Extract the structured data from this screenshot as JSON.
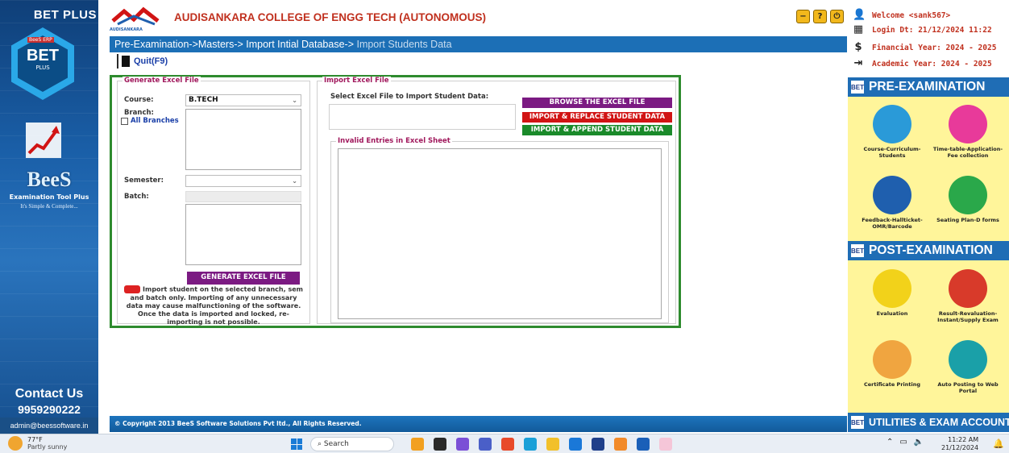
{
  "sidebar": {
    "brand": "BET PLUS",
    "hex_label": "BET",
    "hex_sublabel": "PLUS",
    "hex_tag": "BeeS ERP",
    "bees": "BeeS",
    "tagline": "Examination Tool Plus",
    "slogan": "It's Simple & Complete...",
    "contact_title": "Contact Us",
    "phone": "9959290222",
    "email": "admin@beessoftware.in"
  },
  "header": {
    "logo_text": "AUDISANKARA",
    "college": "AUDISANKARA COLLEGE OF ENGG  TECH (AUTONOMOUS)",
    "breadcrumb_active": "Pre-Examination->Masters-> Import Intial Database->",
    "breadcrumb_dim": " Import Students Data",
    "quit_label": "Quit(F9)",
    "window_buttons": [
      "minimize",
      "help",
      "power"
    ]
  },
  "generate": {
    "legend": "Generate Excel File",
    "course_label": "Course:",
    "course_value": "B.TECH",
    "branch_label": "Branch:",
    "all_branches_label": "All Branches",
    "semester_label": "Semester:",
    "semester_value": "",
    "batch_label": "Batch:",
    "generate_button": "GENERATE EXCEL FILE",
    "note": "Import student on the selected branch, sem and batch only.  Importing of any unnecessary data may cause malfunctioning of the software. Once the data is imported and locked, re-importing is not possible."
  },
  "import": {
    "legend": "Import Excel File",
    "select_label": "Select Excel File to Import Student Data:",
    "browse_button": "BROWSE THE EXCEL FILE",
    "replace_button": "IMPORT & REPLACE STUDENT DATA",
    "append_button": "IMPORT & APPEND STUDENT DATA",
    "invalid_legend": "Invalid Entries in Excel Sheet"
  },
  "footer": {
    "copyright": "© Copyright 2013 BeeS Software Solutions Pvt ltd., All Rights Reserved."
  },
  "userinfo": {
    "welcome": "Welcome <sank567>",
    "login": "Login Dt: 21/12/2024 11:22",
    "financial": "Financial Year: 2024 - 2025",
    "academic": "Academic Year: 2024 - 2025"
  },
  "modules": {
    "bet_badge": "BET",
    "pre_title": "PRE-EXAMINATION",
    "pre_items": [
      {
        "label": "Course-Curriculum-Students",
        "icon": "people-icon",
        "color": "#2a9ad8"
      },
      {
        "label": "Time-table-Application-Fee collection",
        "icon": "hourglass-icon",
        "color": "#e83a9a"
      },
      {
        "label": "Feedback-Hallticket-OMR/Barcode",
        "icon": "monitor-icon",
        "color": "#1f5fae"
      },
      {
        "label": "Seating Plan-D forms",
        "icon": "seating-icon",
        "color": "#2aa84a"
      }
    ],
    "post_title": "POST-EXAMINATION",
    "post_items": [
      {
        "label": "Evaluation",
        "icon": "eyes-icon",
        "color": "#f2d21a"
      },
      {
        "label": "Result-Revaluation-Instant/Supply Exam",
        "icon": "results-icon",
        "color": "#d83a2a"
      },
      {
        "label": "Certificate Printing",
        "icon": "certificate-icon",
        "color": "#f0a540"
      },
      {
        "label": "Auto Posting to Web Portal",
        "icon": "laptop-icon",
        "color": "#1aa0a8"
      }
    ],
    "util_title": "UTILITIES & EXAM ACCOUNT"
  },
  "taskbar": {
    "temp": "77°F",
    "weather": "Partly sunny",
    "search_placeholder": "Search",
    "time": "11:22 AM",
    "date": "21/12/2024"
  }
}
